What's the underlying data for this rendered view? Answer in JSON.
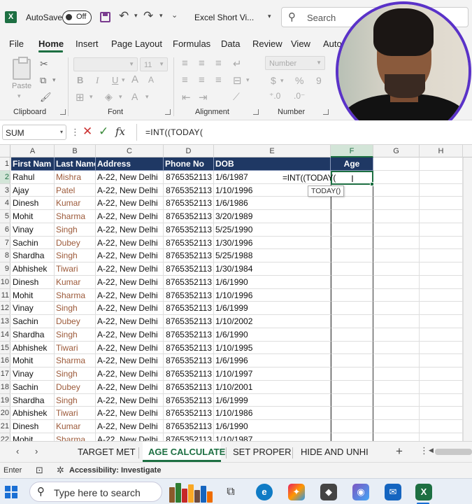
{
  "titlebar": {
    "app_icon": "X",
    "autosave_label": "AutoSave",
    "autosave_state": "Off",
    "doc_title": "Excel Short Vi...",
    "search_placeholder": "Search"
  },
  "menu": [
    "File",
    "Home",
    "Insert",
    "Page Layout",
    "Formulas",
    "Data",
    "Review",
    "View",
    "Auto"
  ],
  "ribbon": {
    "paste_label": "Paste",
    "font_size": "11",
    "number_format": "Number",
    "groups": {
      "clipboard": "Clipboard",
      "font": "Font",
      "alignment": "Alignment",
      "number": "Number"
    },
    "font_buttons": [
      "B",
      "I",
      "U"
    ],
    "number_buttons": [
      "$",
      "%",
      "9"
    ]
  },
  "formula_bar": {
    "name_box": "SUM",
    "formula": "=INT((TODAY("
  },
  "columns": [
    "A",
    "B",
    "C",
    "D",
    "E",
    "F",
    "G",
    "H"
  ],
  "table": {
    "headers": [
      "First Nam",
      "Last Name",
      "Address",
      "Phone No",
      "DOB",
      "",
      "Age"
    ],
    "rows": [
      [
        "Rahul",
        "Mishra",
        "A-22, New Delhi",
        "8765352113",
        "1/6/1987"
      ],
      [
        "Ajay",
        "Patel",
        "A-22, New Delhi",
        "8765352113",
        "1/10/1996"
      ],
      [
        "Dinesh",
        "Kumar",
        "A-22, New Delhi",
        "8765352113",
        "1/6/1986"
      ],
      [
        "Mohit",
        "Sharma",
        "A-22, New Delhi",
        "8765352113",
        "3/20/1989"
      ],
      [
        "Vinay",
        "Singh",
        "A-22, New Delhi",
        "8765352113",
        "5/25/1990"
      ],
      [
        "Sachin",
        "Dubey",
        "A-22, New Delhi",
        "8765352113",
        "1/30/1996"
      ],
      [
        "Shardha",
        "Singh",
        "A-22, New Delhi",
        "8765352113",
        "5/25/1988"
      ],
      [
        "Abhishek",
        "Tiwari",
        "A-22, New Delhi",
        "8765352113",
        "1/30/1984"
      ],
      [
        "Dinesh",
        "Kumar",
        "A-22, New Delhi",
        "8765352113",
        "1/6/1990"
      ],
      [
        "Mohit",
        "Sharma",
        "A-22, New Delhi",
        "8765352113",
        "1/10/1996"
      ],
      [
        "Vinay",
        "Singh",
        "A-22, New Delhi",
        "8765352113",
        "1/6/1999"
      ],
      [
        "Sachin",
        "Dubey",
        "A-22, New Delhi",
        "8765352113",
        "1/10/2002"
      ],
      [
        "Shardha",
        "Singh",
        "A-22, New Delhi",
        "8765352113",
        "1/6/1990"
      ],
      [
        "Abhishek",
        "Tiwari",
        "A-22, New Delhi",
        "8765352113",
        "1/10/1995"
      ],
      [
        "Mohit",
        "Sharma",
        "A-22, New Delhi",
        "8765352113",
        "1/6/1996"
      ],
      [
        "Vinay",
        "Singh",
        "A-22, New Delhi",
        "8765352113",
        "1/10/1997"
      ],
      [
        "Sachin",
        "Dubey",
        "A-22, New Delhi",
        "8765352113",
        "1/10/2001"
      ],
      [
        "Shardha",
        "Singh",
        "A-22, New Delhi",
        "8765352113",
        "1/6/1999"
      ],
      [
        "Abhishek",
        "Tiwari",
        "A-22, New Delhi",
        "8765352113",
        "1/10/1986"
      ],
      [
        "Dinesh",
        "Kumar",
        "A-22, New Delhi",
        "8765352113",
        "1/6/1990"
      ],
      [
        "Mohit",
        "Sharma",
        "A-22, New Delhi",
        "8765352113",
        "1/10/1987"
      ]
    ],
    "editing_cell_text": "=INT((TODAY(",
    "tooltip": "TODAY()"
  },
  "sheet_tabs": [
    "TARGET MET",
    "AGE CALCULATE",
    "SET PROPER",
    "HIDE AND UNHI"
  ],
  "active_sheet": "AGE CALCULATE",
  "status": {
    "mode": "Enter",
    "accessibility": "Accessibility: Investigate"
  },
  "taskbar": {
    "search_placeholder": "Type here to search"
  },
  "colors": {
    "excel_green": "#1d6f42",
    "header_fill": "#1f3864",
    "webcam_border": "#5a32c8"
  }
}
